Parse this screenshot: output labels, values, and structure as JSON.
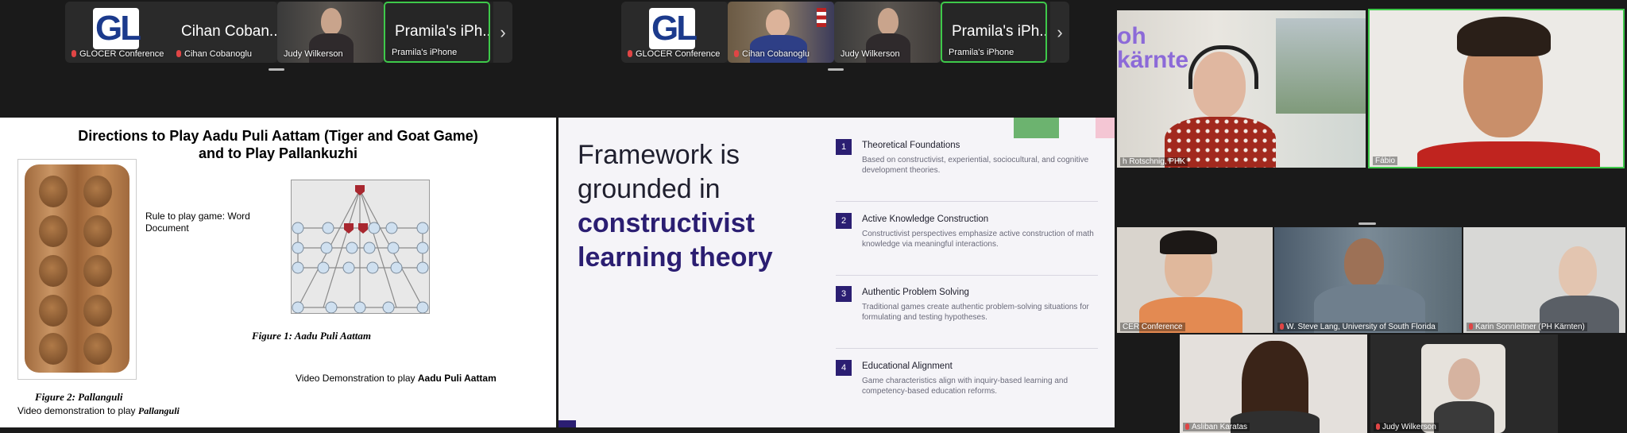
{
  "strip_left": {
    "tiles": [
      {
        "name": "GLOCER Conference",
        "logo": "GL"
      },
      {
        "name": "Cihan Cobanoglu",
        "big_label": "Cihan Coban..."
      },
      {
        "name": "Judy Wilkerson"
      },
      {
        "name": "Pramila's iPhone",
        "big_label": "Pramila's iPh..."
      }
    ],
    "next_icon": "›"
  },
  "strip_right": {
    "tiles": [
      {
        "name": "GLOCER Conference",
        "logo": "GL"
      },
      {
        "name": "Cihan Cobanoglu"
      },
      {
        "name": "Judy Wilkerson"
      },
      {
        "name": "Pramila's iPhone",
        "big_label": "Pramila's iPh..."
      }
    ],
    "next_icon": "›"
  },
  "slide1": {
    "title_line1": "Directions to Play Aadu Puli Aattam (Tiger and Goat Game)",
    "title_line2": "and to Play Pallankuzhi",
    "rule_text": "Rule to play game: Word Document",
    "figure1_caption": "Figure 1: Aadu Puli Aattam",
    "video_demo_tiger_prefix": "Video Demonstration to play ",
    "video_demo_tiger_bold": "Aadu Puli Aattam",
    "figure2_caption": "Figure 2: Pallanguli",
    "video_demo_pall_prefix": "Video demonstration to play ",
    "video_demo_pall_bold": "Pallanguli"
  },
  "slide2": {
    "heading_line1": "Framework is",
    "heading_line2": "grounded in",
    "heading_hl1": "constructivist",
    "heading_hl2": "learning theory",
    "items": [
      {
        "num": "1",
        "title": "Theoretical Foundations",
        "desc": "Based on constructivist, experiential, sociocultural, and cognitive development theories."
      },
      {
        "num": "2",
        "title": "Active Knowledge Construction",
        "desc": "Constructivist perspectives emphasize active construction of math knowledge via meaningful interactions."
      },
      {
        "num": "3",
        "title": "Authentic Problem Solving",
        "desc": "Traditional games create authentic problem-solving situations for formulating and testing hypotheses."
      },
      {
        "num": "4",
        "title": "Educational Alignment",
        "desc": "Game characteristics align with inquiry-based learning and competency-based education reforms."
      }
    ]
  },
  "gallery": {
    "top_left_name": "h Rotschnig, PHK",
    "top_left_wall_text": "oh\nkärnte",
    "top_right_name": "Fábio",
    "mid1_name": "CER Conference",
    "mid2_name": "W. Steve Lang, University of South Florida",
    "mid3_name": "Karin Sonnleitner (PH Kärnten)",
    "bot1_name": "Asliban Karatas",
    "bot2_name": "Judy Wilkerson"
  }
}
